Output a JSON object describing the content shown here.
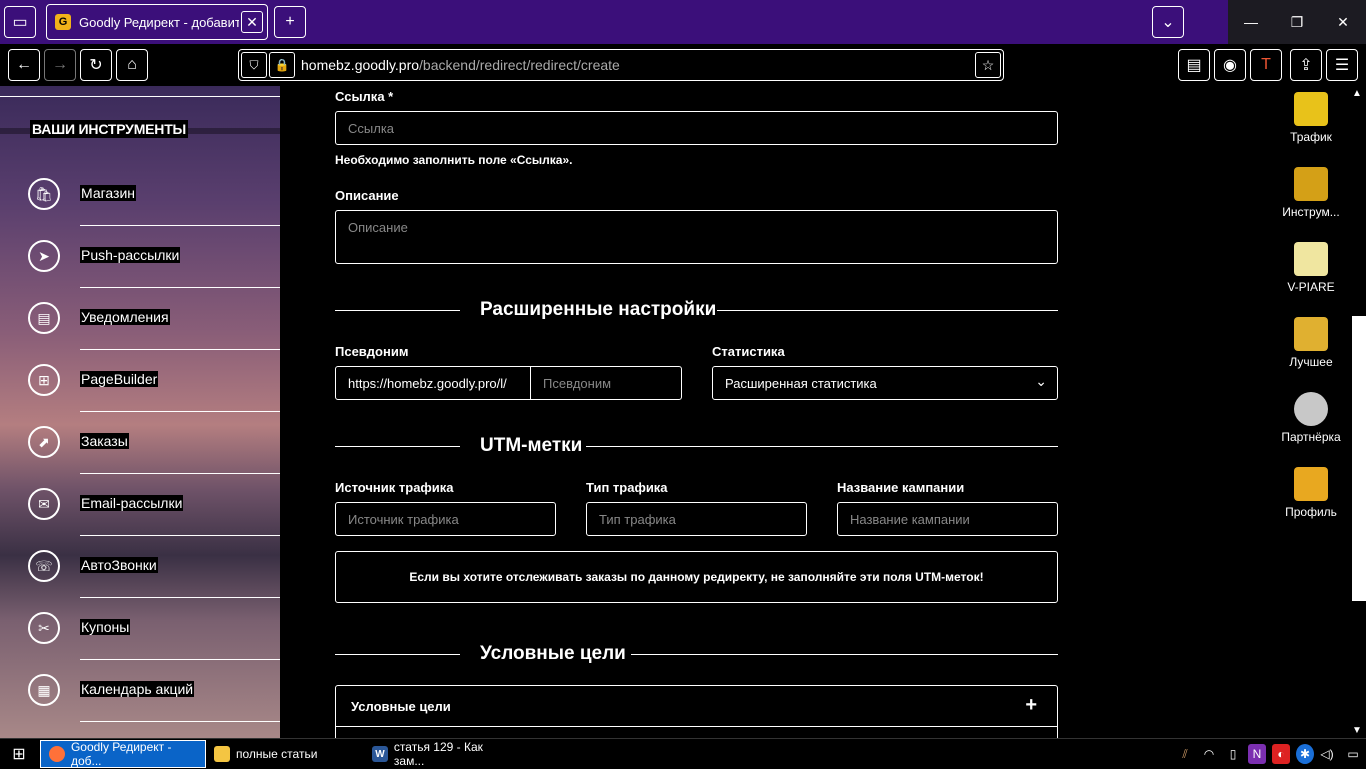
{
  "browser": {
    "tab_title": "Goodly Редирект - добавить",
    "tab_favicon": "G",
    "url_domain": "homebz.goodly.pro",
    "url_path": "/backend/redirect/redirect/create",
    "icons": {
      "tab_manager": "▭",
      "tab_close": "✕",
      "new_tab": "+",
      "list_tabs": "⌄",
      "minimize": "—",
      "restore": "❐",
      "close": "✕",
      "back": "←",
      "forward": "→",
      "reload": "↻",
      "home": "⌂",
      "shield": "⛉",
      "lock": "🔒",
      "star": "☆",
      "reader": "▤",
      "account": "◉",
      "extension": "T",
      "share": "⇪",
      "menu": "☰"
    }
  },
  "sidebar": {
    "heading": "ВАШИ ИНСТРУМЕНТЫ",
    "items": [
      {
        "label": "Магазин",
        "icon": "🛍"
      },
      {
        "label": "Push-рассылки",
        "icon": "➤"
      },
      {
        "label": "Уведомления",
        "icon": "▤"
      },
      {
        "label": "PageBuilder",
        "icon": "⊞"
      },
      {
        "label": "Заказы",
        "icon": "⬈"
      },
      {
        "label": "Email-рассылки",
        "icon": "✉"
      },
      {
        "label": "АвтоЗвонки",
        "icon": "☏"
      },
      {
        "label": "Купоны",
        "icon": "✂"
      },
      {
        "label": "Календарь акций",
        "icon": "▦"
      }
    ]
  },
  "form": {
    "link_label": "Ссылка *",
    "link_placeholder": "Ссылка",
    "link_error": "Необходимо заполнить поле «Ссылка».",
    "description_label": "Описание",
    "description_placeholder": "Описание",
    "advanced_title": "Расширенные настройки",
    "alias_label": "Псевдоним",
    "alias_prefix": "https://homebz.goodly.pro/l/",
    "alias_placeholder": "Псевдоним",
    "stats_label": "Статистика",
    "stats_value": "Расширенная статистика",
    "utm_title": "UTM-метки",
    "utm_source_label": "Источник трафика",
    "utm_source_placeholder": "Источник трафика",
    "utm_medium_label": "Тип трафика",
    "utm_medium_placeholder": "Тип трафика",
    "utm_campaign_label": "Название кампании",
    "utm_campaign_placeholder": "Название кампании",
    "utm_notice": "Если вы хотите отслеживать заказы по данному редиректу, не заполняйте эти поля UTM-меток!",
    "goals_title": "Условные цели",
    "goals_accordion_label": "Условные цели",
    "goals_plus": "+",
    "select_arrow": "⌄"
  },
  "desktop": {
    "items": [
      {
        "label": "Трафик",
        "color": "#e8c21a"
      },
      {
        "label": "Инструм...",
        "color": "#d4a017"
      },
      {
        "label": "V-PIARE",
        "color": "#f0e6a0"
      },
      {
        "label": "Лучшее",
        "color": "#e0b030"
      },
      {
        "label": "Партнёрка",
        "color": "#c8c8c8"
      },
      {
        "label": "Профиль",
        "color": "#e8a820"
      }
    ],
    "scroll_up": "▲",
    "scroll_down": "▼"
  },
  "taskbar": {
    "start_icon": "⊞",
    "items": [
      {
        "label": "Goodly Редирект - доб...",
        "icon": "●",
        "color": "#ff7139"
      },
      {
        "label": "полные статьи",
        "icon": "",
        "color": "#f4c542"
      },
      {
        "label": "статья 129 - Как зам...",
        "icon": "W",
        "color": "#2b5797"
      }
    ],
    "tray": [
      "⫽",
      "◠",
      "▯",
      "N",
      "◐",
      "✱",
      "◁)",
      "▭"
    ]
  }
}
